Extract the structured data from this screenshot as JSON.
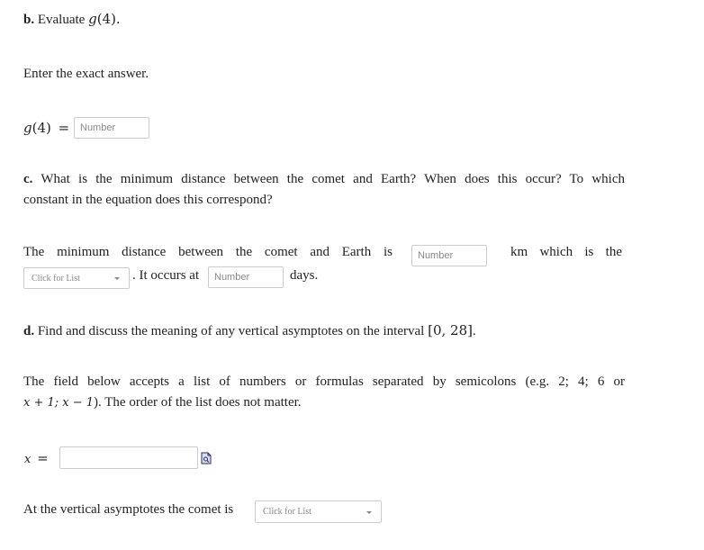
{
  "part_b": {
    "label": "b.",
    "text": "Evaluate",
    "func": "g",
    "arg": "(4).",
    "instruction": "Enter the exact answer.",
    "answer_lhs_func": "g",
    "answer_lhs_arg": "(4)",
    "equals": "=",
    "input_placeholder": "Number"
  },
  "part_c": {
    "label": "c.",
    "question_line1": "What is the minimum distance between the comet and Earth? When does this occur? To which",
    "question_line2": "constant in the equation does this correspond?",
    "sentence_part1": "The minimum distance between the comet and Earth is",
    "distance_placeholder": "Number",
    "sentence_part2": "km which is the",
    "dropdown_placeholder": "Click for List",
    "sentence_part3": ". It occurs at",
    "days_placeholder": "Number",
    "sentence_part4": "days."
  },
  "part_d": {
    "label": "d.",
    "question": "Find and discuss the meaning of any vertical asymptotes on the interval",
    "interval": "[0, 28]",
    "period": ".",
    "help_line1": "The field below accepts a list of numbers or formulas separated by semicolons (e.g. 2; 4; 6 or",
    "help_line2_math": "x + 1; x − 1",
    "help_line2_rest": "). The order of the list does not matter.",
    "x_label": "x",
    "x_equals": "=",
    "x_input_value": "",
    "preview_icon": "formula-preview-icon",
    "asymptote_sentence": "At the vertical asymptotes the comet is",
    "asymptote_dropdown_placeholder": "Click for List"
  }
}
